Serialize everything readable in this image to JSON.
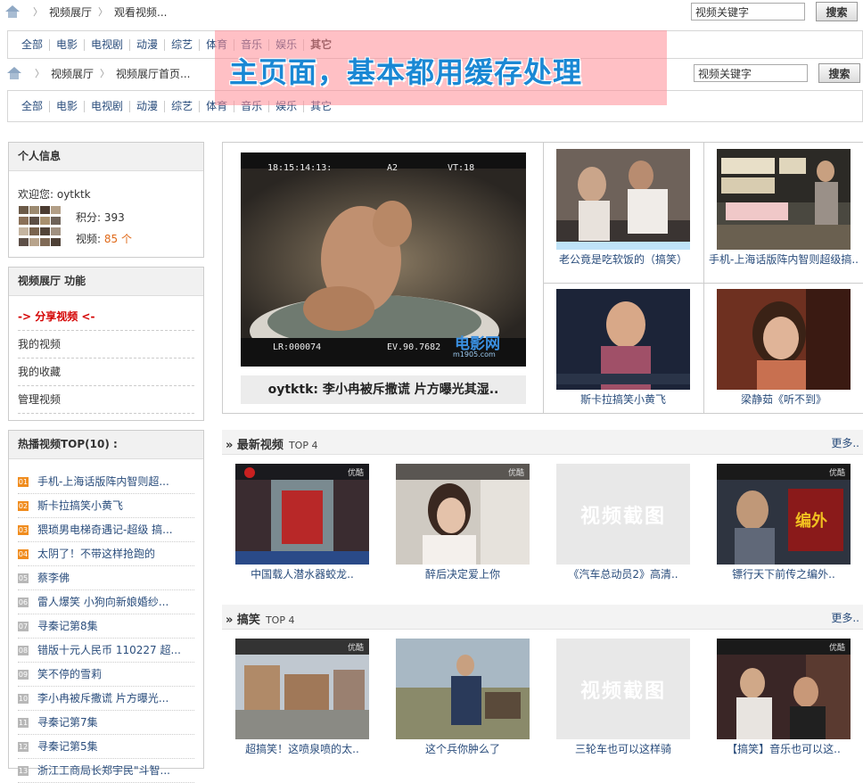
{
  "breadcrumb_top": {
    "home": "home-icon",
    "items": [
      "视频展厅",
      "观看视频..."
    ]
  },
  "breadcrumb_second": {
    "home": "home-icon",
    "items": [
      "视频展厅",
      "视频展厅首页..."
    ]
  },
  "search": {
    "value": "视频关键字",
    "button": "搜索"
  },
  "nav": [
    "全部",
    "电影",
    "电视剧",
    "动漫",
    "综艺",
    "体育",
    "音乐",
    "娱乐",
    "其它"
  ],
  "overlay_note": "主页面，基本都用缓存处理",
  "profile": {
    "title": "个人信息",
    "welcome": "欢迎您: oytktk",
    "points_label": "积分: ",
    "points": "393",
    "videos_label": "视频: ",
    "videos": "85 个"
  },
  "functions": {
    "title": "视频展厅 功能",
    "items": [
      "-> 分享视频 <-",
      "我的视频",
      "我的收藏",
      "管理视频"
    ]
  },
  "hot": {
    "title": "热播视频TOP(10) :",
    "items": [
      {
        "rank": "01",
        "title": "手机-上海话版阵内智则超..."
      },
      {
        "rank": "02",
        "title": "斯卡拉搞笑小黄飞"
      },
      {
        "rank": "03",
        "title": "猥琐男电梯奇遇记-超级 搞..."
      },
      {
        "rank": "04",
        "title": "太阴了！不带这样抢跑的"
      },
      {
        "rank": "05",
        "title": "蔡李佛"
      },
      {
        "rank": "06",
        "title": "雷人爆笑 小狗向新娘婚纱..."
      },
      {
        "rank": "07",
        "title": "寻秦记第8集"
      },
      {
        "rank": "08",
        "title": "错版十元人民币 110227 超..."
      },
      {
        "rank": "09",
        "title": "笑不停的雪莉"
      },
      {
        "rank": "10",
        "title": "李小冉被斥撒谎 片方曝光..."
      },
      {
        "rank": "11",
        "title": "寻秦记第7集"
      },
      {
        "rank": "12",
        "title": "寻秦记第5集"
      },
      {
        "rank": "13",
        "title": "浙江工商局长郑宇民\"斗智..."
      }
    ]
  },
  "featured": {
    "main_caption": "oytktk: 李小冉被斥撒谎 片方曝光其湿..",
    "video_overlay": {
      "time": "18:15:14:13:",
      "a2": "A2",
      "vt": "VT:18",
      "lr": "LR:000074",
      "ev": "EV.90.7682",
      "logo": "电影网",
      "logo_sub": "m1905.com"
    },
    "side": [
      {
        "title": "老公竟是吃软饭的（搞笑）"
      },
      {
        "title": "手机-上海话版阵内智则超级搞.."
      },
      {
        "title": "斯卡拉搞笑小黄飞"
      },
      {
        "title": "梁静茹《听不到》"
      }
    ]
  },
  "latest": {
    "title": "» 最新视频",
    "sub": "TOP 4",
    "more": "更多..",
    "items": [
      {
        "title": "中国载人潜水器蛟龙..",
        "watermark": "优酷"
      },
      {
        "title": "醉后决定爱上你",
        "watermark": "优酷"
      },
      {
        "title": "《汽车总动员2》高清..",
        "placeholder": "视频截图"
      },
      {
        "title": "镖行天下前传之编外..",
        "watermark": "优酷"
      }
    ]
  },
  "funny": {
    "title": "» 搞笑",
    "sub": "TOP 4",
    "more": "更多..",
    "items": [
      {
        "title": "超搞笑！这喷泉喷的太..",
        "watermark": "优酷"
      },
      {
        "title": "这个兵你肿么了",
        "watermark": ""
      },
      {
        "title": "三轮车也可以这样骑",
        "placeholder": "视频截图"
      },
      {
        "title": "【搞笑】音乐也可以这..",
        "watermark": "优酷"
      }
    ]
  }
}
